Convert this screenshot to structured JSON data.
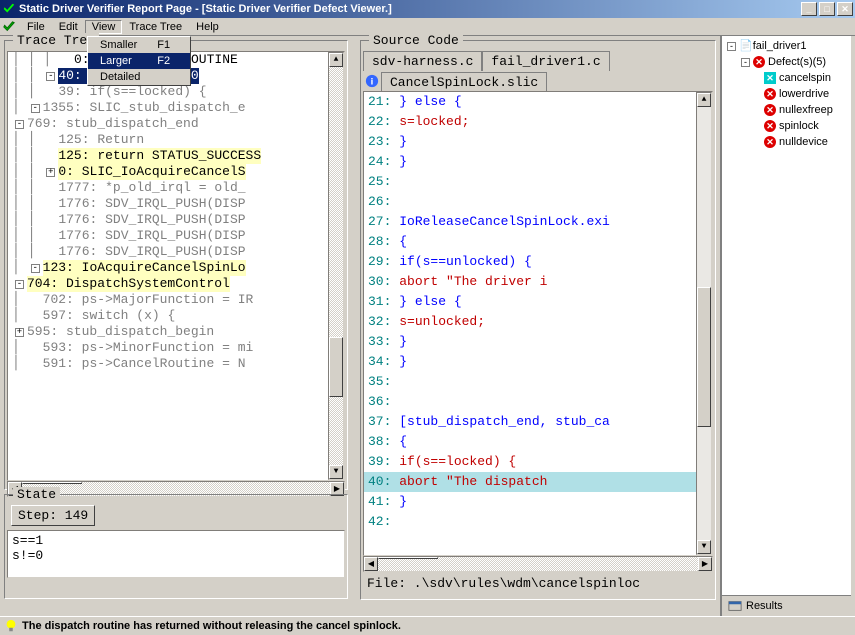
{
  "window": {
    "title": "Static Driver Verifier Report Page - [Static Driver Verifier Defect Viewer.]"
  },
  "menu": {
    "items": [
      "File",
      "Edit",
      "View",
      "Trace Tree",
      "Help"
    ],
    "dropdown": [
      {
        "label": "Smaller",
        "shortcut": "F1"
      },
      {
        "label": "Larger",
        "shortcut": "F2"
      },
      {
        "label": "Detailed",
        "shortcut": ""
      }
    ]
  },
  "trace": {
    "title": "Trace Tree",
    "lines": [
      {
        "indent": 1,
        "expand": "",
        "text": "591: ps->CancelRoutine = N",
        "cls": "trace-grey"
      },
      {
        "indent": 1,
        "expand": "",
        "text": "593: ps->MinorFunction = mi",
        "cls": "trace-grey"
      },
      {
        "indent": 0,
        "expand": "+",
        "text": "595: stub_dispatch_begin",
        "cls": "trace-grey"
      },
      {
        "indent": 1,
        "expand": "",
        "text": "597: switch (x) {",
        "cls": "trace-grey"
      },
      {
        "indent": 1,
        "expand": "",
        "text": "702: ps->MajorFunction = IR",
        "cls": "trace-grey"
      },
      {
        "indent": 0,
        "expand": "-",
        "text": "704: DispatchSystemControl",
        "cls": "trace-highlighted"
      },
      {
        "indent": 1,
        "expand": "-",
        "text": "123: IoAcquireCancelSpinLo",
        "cls": "trace-highlighted"
      },
      {
        "indent": 2,
        "expand": "",
        "text": "1776: SDV_IRQL_PUSH(DISP",
        "cls": "trace-grey"
      },
      {
        "indent": 2,
        "expand": "",
        "text": "1776: SDV_IRQL_PUSH(DISP",
        "cls": "trace-grey"
      },
      {
        "indent": 2,
        "expand": "",
        "text": "1776: SDV_IRQL_PUSH(DISP",
        "cls": "trace-grey"
      },
      {
        "indent": 2,
        "expand": "",
        "text": "1776: SDV_IRQL_PUSH(DISP",
        "cls": "trace-grey"
      },
      {
        "indent": 2,
        "expand": "",
        "text": "1777: *p_old_irql = old_",
        "cls": "trace-grey"
      },
      {
        "indent": 2,
        "expand": "+",
        "text": "0: SLIC_IoAcquireCancelS",
        "cls": "trace-highlighted"
      },
      {
        "indent": 2,
        "expand": "",
        "text": "125: return STATUS_SUCCESS",
        "cls": "trace-highlighted"
      },
      {
        "indent": 2,
        "expand": "",
        "text": "125: Return",
        "cls": "trace-grey"
      },
      {
        "indent": 0,
        "expand": "-",
        "text": "769: stub_dispatch_end",
        "cls": "trace-grey"
      },
      {
        "indent": 1,
        "expand": "-",
        "text": "1355: SLIC_stub_dispatch_e",
        "cls": "trace-grey"
      },
      {
        "indent": 2,
        "expand": "",
        "text": "39: if(s==locked) {",
        "cls": "trace-grey"
      },
      {
        "indent": 2,
        "expand": "-",
        "text": "40: SLIC_ABORT_3_0",
        "cls": "trace-selected"
      },
      {
        "indent": 3,
        "expand": "",
        "text": "0: SLIC_ERROR_ROUTINE",
        "cls": ""
      }
    ]
  },
  "state": {
    "title": "State",
    "step": "Step: 149",
    "vars": [
      "s==1",
      "s!=0"
    ]
  },
  "source": {
    "title": "Source Code",
    "tabs": [
      "sdv-harness.c",
      "fail_driver1.c"
    ],
    "active_tab": "CancelSpinLock.slic",
    "lines": [
      {
        "no": "21",
        "text": "    } else {",
        "cls": "src-blue"
      },
      {
        "no": "22",
        "text": "        s=locked;",
        "cls": "src-red"
      },
      {
        "no": "23",
        "text": "    }",
        "cls": "src-blue"
      },
      {
        "no": "24",
        "text": "}",
        "cls": "src-blue"
      },
      {
        "no": "25",
        "text": "",
        "cls": ""
      },
      {
        "no": "26",
        "text": "",
        "cls": ""
      },
      {
        "no": "27",
        "text": "IoReleaseCancelSpinLock.exi",
        "cls": "src-blue"
      },
      {
        "no": "28",
        "text": "{",
        "cls": "src-blue"
      },
      {
        "no": "29",
        "text": "    if(s==unlocked) {",
        "cls": "src-blue"
      },
      {
        "no": "30",
        "text": "        abort \"The driver i",
        "cls": "src-red"
      },
      {
        "no": "31",
        "text": "    } else {",
        "cls": "src-blue"
      },
      {
        "no": "32",
        "text": "        s=unlocked;",
        "cls": "src-red"
      },
      {
        "no": "33",
        "text": "    }",
        "cls": "src-blue"
      },
      {
        "no": "34",
        "text": "}",
        "cls": "src-blue"
      },
      {
        "no": "35",
        "text": "",
        "cls": ""
      },
      {
        "no": "36",
        "text": "",
        "cls": ""
      },
      {
        "no": "37",
        "text": "[stub_dispatch_end, stub_ca",
        "cls": "src-blue"
      },
      {
        "no": "38",
        "text": "{",
        "cls": "src-blue"
      },
      {
        "no": "39",
        "text": "    if(s==locked) {",
        "cls": "src-red"
      },
      {
        "no": "40",
        "text": "        abort \"The dispatch",
        "cls": "src-red",
        "hl": true
      },
      {
        "no": "41",
        "text": "    }",
        "cls": "src-blue"
      },
      {
        "no": "42",
        "text": "",
        "cls": ""
      }
    ],
    "file_path": "File: .\\sdv\\rules\\wdm\\cancelspinloc"
  },
  "defects": {
    "root": "fail_driver1",
    "group": "Defect(s)(5)",
    "items": [
      {
        "name": "cancelspin",
        "icon": "cyan"
      },
      {
        "name": "lowerdrive",
        "icon": "red"
      },
      {
        "name": "nullexfreep",
        "icon": "red"
      },
      {
        "name": "spinlock",
        "icon": "red"
      },
      {
        "name": "nulldevice",
        "icon": "red"
      }
    ],
    "results_tab": "Results"
  },
  "statusbar": {
    "message": "The dispatch routine has returned without releasing the cancel spinlock."
  }
}
